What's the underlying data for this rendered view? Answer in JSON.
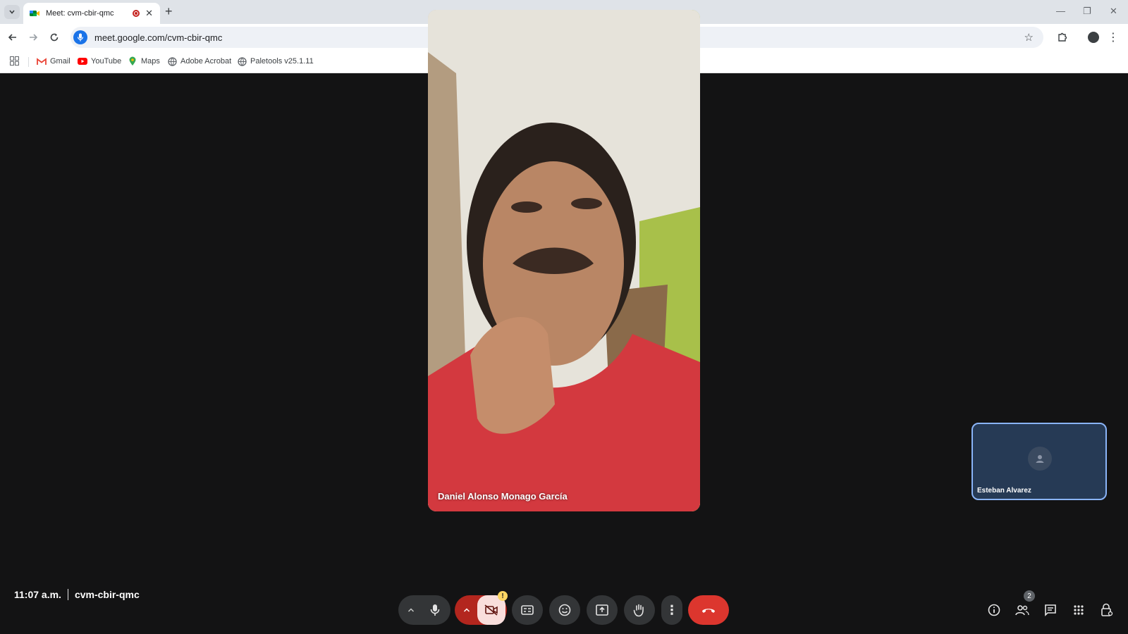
{
  "browser": {
    "tab_title": "Meet: cvm-cbir-qmc",
    "tab_close": "✕",
    "new_tab": "+",
    "url": "meet.google.com/cvm-cbir-qmc",
    "bookmarks": [
      {
        "label": "Gmail",
        "icon": "gmail-icon"
      },
      {
        "label": "YouTube",
        "icon": "youtube-icon"
      },
      {
        "label": "Maps",
        "icon": "maps-icon"
      },
      {
        "label": "Adobe Acrobat",
        "icon": "globe-icon"
      },
      {
        "label": "Paletools v25.1.11",
        "icon": "globe-icon"
      }
    ]
  },
  "meet": {
    "main_participant": "Daniel Alonso Monago García",
    "self_participant": "Esteban Alvarez",
    "time": "11:07 a.m.",
    "meeting_code": "cvm-cbir-qmc",
    "camera_warning": "!",
    "people_count": "2"
  },
  "colors": {
    "end_call": "#dc362e",
    "self_tile_border": "#8ab4f8",
    "background": "#131314"
  }
}
